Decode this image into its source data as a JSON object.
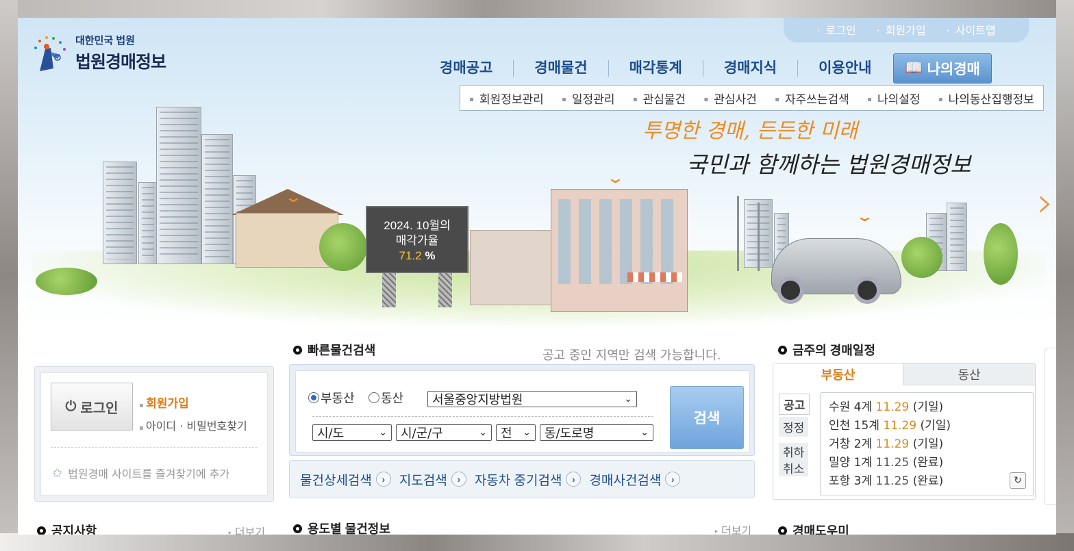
{
  "logo": {
    "subtitle": "대한민국 법원",
    "title": "법원경매정보"
  },
  "util_links": [
    "로그인",
    "회원가입",
    "사이트맵"
  ],
  "main_nav": [
    "경매공고",
    "경매물건",
    "매각통계",
    "경매지식",
    "이용안내"
  ],
  "my_auction": {
    "label": "나의경매",
    "icon": "book-icon"
  },
  "sub_nav": [
    "회원정보관리",
    "일정관리",
    "관심물건",
    "관심사건",
    "자주쓰는검색",
    "나의설정",
    "나의동산집행정보"
  ],
  "hero": {
    "slogan_line1": "투명한 경매, 든든한 미래",
    "slogan_line2": "국민과 함께하는 법원경매정보",
    "billboard_line1": "2024. 10월의",
    "billboard_line2": "매각가율",
    "billboard_rate": "71.2",
    "billboard_unit": "%"
  },
  "login": {
    "button": "로그인",
    "join": "회원가입",
    "find": "아이디 · 비밀번호찾기",
    "favorite": "법원경매 사이트를 즐겨찾기에 추가"
  },
  "quick_search": {
    "title": "빠른물건검색",
    "note": "공고 중인 지역만 검색 가능합니다.",
    "radio_realestate": "부동산",
    "radio_movable": "동산",
    "court": "서울중앙지방법원",
    "sido": "시/도",
    "sigungu": "시/군/구",
    "jeon": "전",
    "dong": "동/도로명",
    "search_button": "검색",
    "links": [
      "물건상세검색",
      "지도검색",
      "자동차 중기검색",
      "경매사건검색"
    ]
  },
  "schedule": {
    "title": "금주의 경매일정",
    "tabs": [
      "부동산",
      "동산"
    ],
    "behind": [
      "공고",
      "정정",
      "취하",
      "취소"
    ],
    "items": [
      {
        "place": "수원 4계",
        "date": "11.29",
        "status": "(기일)"
      },
      {
        "place": "인천 15계",
        "date": "11.29",
        "status": "(기일)"
      },
      {
        "place": "거창 2계",
        "date": "11.29",
        "status": "(기일)"
      },
      {
        "place": "밀양 1계",
        "date": "11.25",
        "status": "(완료)"
      },
      {
        "place": "포항 3계",
        "date": "11.25",
        "status": "(완료)"
      }
    ]
  },
  "bottom_sections": {
    "notice": "공지사항",
    "notice_more": "더보기",
    "usage": "용도별 물건정보",
    "usage_more": "더보기",
    "helper": "경매도우미"
  },
  "colors": {
    "accent_orange": "#e07b14",
    "nav_blue": "#1d4b8a",
    "search_blue": "#6fa4dd"
  }
}
